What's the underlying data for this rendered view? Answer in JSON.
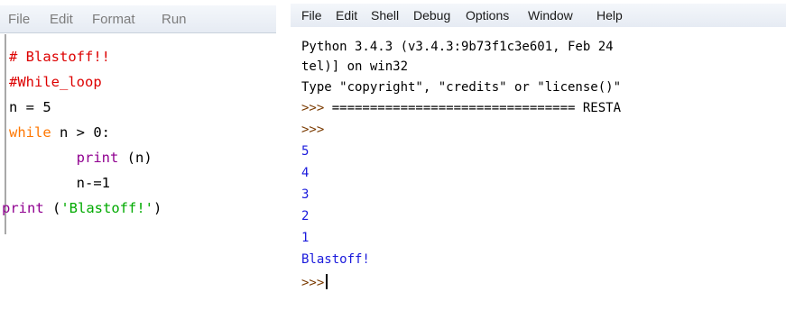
{
  "editor": {
    "menu": [
      "File",
      "Edit",
      "Format",
      "Run"
    ],
    "code": {
      "line1": "# Blastoff!!",
      "line2": "#While_loop",
      "line3": "n = 5",
      "line4_kw": "while",
      "line4_rest": " n > 0:",
      "line5_indent": "        ",
      "line5_fn": "print",
      "line5_rest": " (n)",
      "line6": "        n-=1",
      "line7_fn": "print",
      "line7_open": " (",
      "line7_str": "'Blastoff!'",
      "line7_close": ")"
    }
  },
  "shell": {
    "menu": [
      "File",
      "Edit",
      "Shell",
      "Debug",
      "Options",
      "Window",
      "Help"
    ],
    "lines": {
      "banner1": "Python 3.4.3 (v3.4.3:9b73f1c3e601, Feb 24",
      "banner2": "tel)] on win32",
      "banner3": "Type \"copyright\", \"credits\" or \"license()\"",
      "restart_prompt": ">>> ",
      "restart": "================================ RESTA",
      "prompt1": ">>>",
      "out": [
        "5",
        "4",
        "3",
        "2",
        "1"
      ],
      "out_msg": "Blastoff!",
      "prompt2": ">>>"
    }
  },
  "colors": {
    "comment": "#dd0000",
    "keyword": "#ff7700",
    "builtin": "#900090",
    "string": "#00aa00",
    "shell_output": "#1a1adc",
    "shell_prompt": "#7a3a00"
  }
}
